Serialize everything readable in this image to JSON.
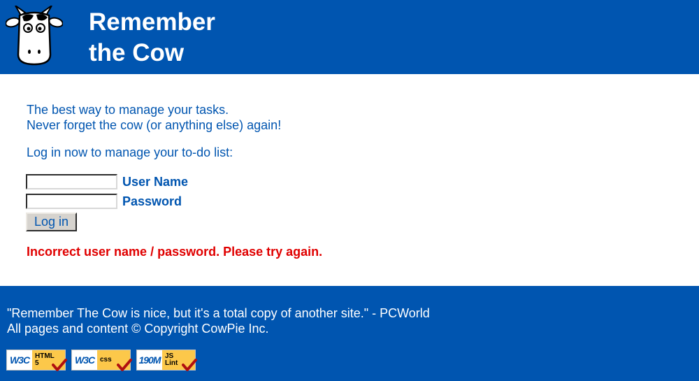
{
  "header": {
    "brand_line1": "Remember",
    "brand_line2": "the Cow"
  },
  "main": {
    "tagline_line1": "The best way to manage your tasks.",
    "tagline_line2": "Never forget the cow (or anything else) again!",
    "prompt": "Log in now to manage your to-do list:",
    "username": {
      "label": "User Name",
      "value": ""
    },
    "password": {
      "label": "Password",
      "value": ""
    },
    "login_button": "Log in",
    "error": "Incorrect user name / password. Please try again."
  },
  "footer": {
    "quote": "\"Remember The Cow is nice, but it's a total copy of another site.\" - PCWorld",
    "copyright": "All pages and content © Copyright CowPie Inc.",
    "badges": [
      {
        "left": "W3C",
        "right_line1": "HTML",
        "right_line2": "5",
        "icon": "check-icon"
      },
      {
        "left": "W3C",
        "right_line1": "css",
        "right_line2": "",
        "icon": "check-icon"
      },
      {
        "left": "190M",
        "right_line1": "JS",
        "right_line2": "Lint",
        "icon": "check-icon"
      }
    ]
  },
  "colors": {
    "brand_blue": "#0055b0",
    "error_red": "#e00000",
    "badge_gold": "#fcc84a",
    "check_red": "#b01010"
  }
}
